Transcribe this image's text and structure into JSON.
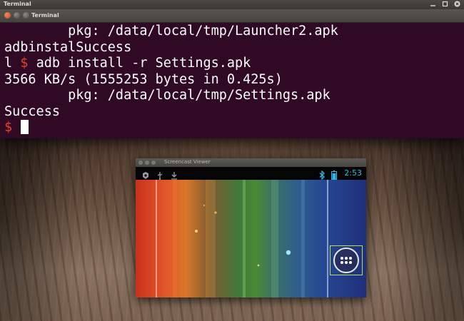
{
  "top_panel": {
    "title": "Terminal"
  },
  "terminal": {
    "title": "Terminal",
    "lines": [
      "        pkg: /data/local/tmp/Launcher2.apk",
      "adbinstalSuccess"
    ],
    "cmd_prefix": "l",
    "prompt_symbol": "$",
    "command": "adb install -r Settings.apk",
    "transfer": "3566 KB/s (1555253 bytes in 0.425s)",
    "pkg_line": "        pkg: /data/local/tmp/Settings.apk",
    "result": "Success",
    "prompt_color": "#e0432c",
    "background_color": "#300a24"
  },
  "viewer": {
    "title": "Screencast Viewer",
    "status": {
      "time": "2:53",
      "left_icons": [
        "usb-debug-icon",
        "usb-icon",
        "download-icon"
      ],
      "right_icons": [
        "bluetooth-icon",
        "battery-icon"
      ],
      "accent_color": "#33b5e5"
    },
    "launcher": {
      "icon": "app-drawer-icon"
    }
  }
}
